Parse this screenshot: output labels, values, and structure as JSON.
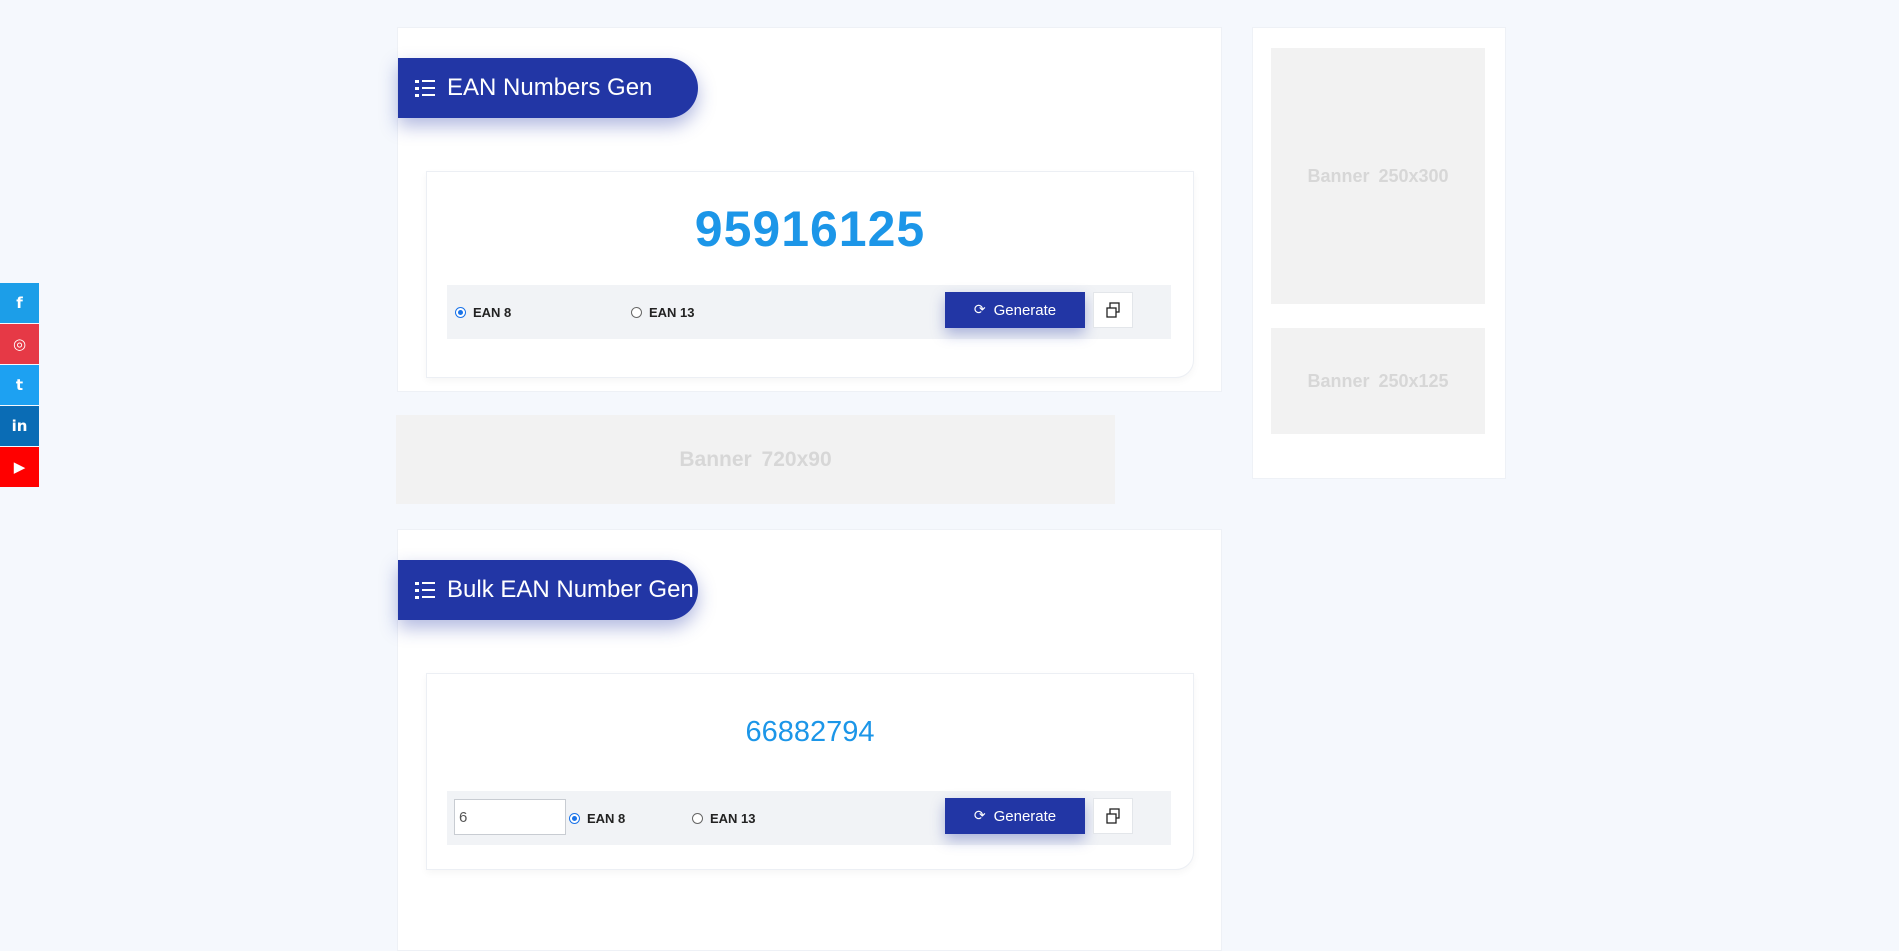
{
  "social": [
    {
      "name": "facebook",
      "glyph": "f",
      "color": "#1c9ee8"
    },
    {
      "name": "instagram",
      "glyph": "◎",
      "color": "#e63946"
    },
    {
      "name": "twitter",
      "glyph": "t",
      "color": "#1da1f2"
    },
    {
      "name": "linkedin",
      "glyph": "in",
      "color": "#0a6cb5"
    },
    {
      "name": "youtube",
      "glyph": "▶",
      "color": "#ff0000"
    }
  ],
  "single": {
    "title": "EAN Numbers Gen",
    "number": "95916125",
    "options": [
      "EAN 8",
      "EAN 13"
    ],
    "selected": "EAN 8",
    "generate_label": "Generate"
  },
  "bulk": {
    "title": "Bulk EAN Number Gen",
    "number": "66882794",
    "quantity": "6",
    "options": [
      "EAN 8",
      "EAN 13"
    ],
    "selected": "EAN 8",
    "generate_label": "Generate"
  },
  "banners": {
    "wide": "Banner  720x90",
    "side_top": "Banner  250x300",
    "side_bottom": "Banner  250x125"
  },
  "colors": {
    "accent": "#2236a5",
    "number": "#1c96e8",
    "page_bg": "#f5f8fd"
  },
  "icons": {
    "title": "list-icon",
    "generate": "refresh-icon",
    "copy": "copy-icon"
  }
}
